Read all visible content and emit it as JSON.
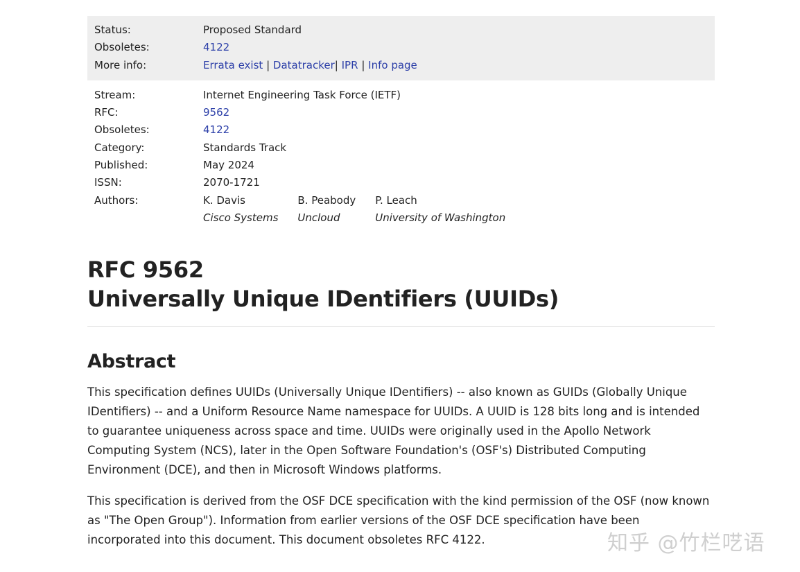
{
  "status_box": {
    "rows": [
      {
        "label": "Status:",
        "value": "Proposed Standard"
      },
      {
        "label": "Obsoletes:",
        "link": "4122"
      },
      {
        "label": "More info:",
        "links": [
          "Errata exist",
          "Datatracker",
          "IPR",
          "Info page"
        ],
        "separator": "|"
      }
    ]
  },
  "meta": {
    "stream_label": "Stream:",
    "stream": "Internet Engineering Task Force (IETF)",
    "rfc_label": "RFC:",
    "rfc": "9562",
    "obsoletes_label": "Obsoletes:",
    "obsoletes": "4122",
    "category_label": "Category:",
    "category": "Standards Track",
    "published_label": "Published:",
    "published": "May 2024",
    "issn_label": "ISSN:",
    "issn": "2070-1721",
    "authors_label": "Authors:",
    "authors": [
      {
        "name": "K. Davis",
        "affiliation": "Cisco Systems"
      },
      {
        "name": "B. Peabody",
        "affiliation": "Uncloud"
      },
      {
        "name": "P. Leach",
        "affiliation": "University of Washington"
      }
    ]
  },
  "title": {
    "line1": "RFC 9562",
    "line2": "Universally Unique IDentifiers (UUIDs)"
  },
  "abstract": {
    "heading": "Abstract",
    "paragraph1": "This specification defines UUIDs (Universally Unique IDentifiers) -- also known as GUIDs (Globally Unique IDentifiers) -- and a Uniform Resource Name namespace for UUIDs. A UUID is 128 bits long and is intended to guarantee uniqueness across space and time. UUIDs were originally used in the Apollo Network Computing System (NCS), later in the Open Software Foundation's (OSF's) Distributed Computing Environment (DCE), and then in Microsoft Windows platforms.",
    "paragraph2": "This specification is derived from the OSF DCE specification with the kind permission of the OSF (now known as \"The Open Group\"). Information from earlier versions of the OSF DCE specification have been incorporated into this document. This document obsoletes RFC 4122."
  },
  "watermark": "知乎 @竹栏呓语",
  "colors": {
    "link": "#2c3fa8",
    "status_bg": "#eeeeee"
  }
}
